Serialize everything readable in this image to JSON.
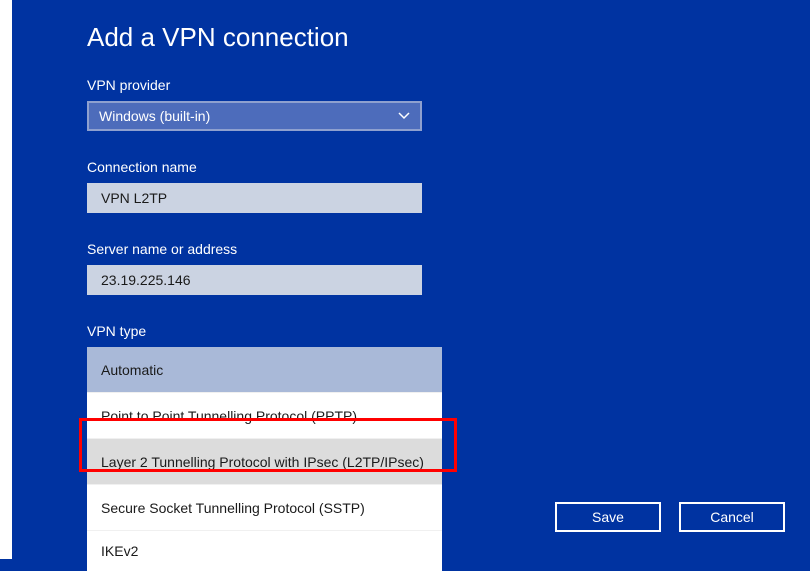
{
  "title": "Add a VPN connection",
  "provider": {
    "label": "VPN provider",
    "value": "Windows (built-in)"
  },
  "connection_name": {
    "label": "Connection name",
    "value": "VPN L2TP"
  },
  "server": {
    "label": "Server name or address",
    "value": "23.19.225.146"
  },
  "vpn_type": {
    "label": "VPN type",
    "options": {
      "0": "Automatic",
      "1": "Point to Point Tunnelling Protocol (PPTP)",
      "2": "Layer 2 Tunnelling Protocol with IPsec (L2TP/IPsec)",
      "3": "Secure Socket Tunnelling Protocol (SSTP)",
      "4": "IKEv2"
    }
  },
  "buttons": {
    "save": "Save",
    "cancel": "Cancel"
  }
}
